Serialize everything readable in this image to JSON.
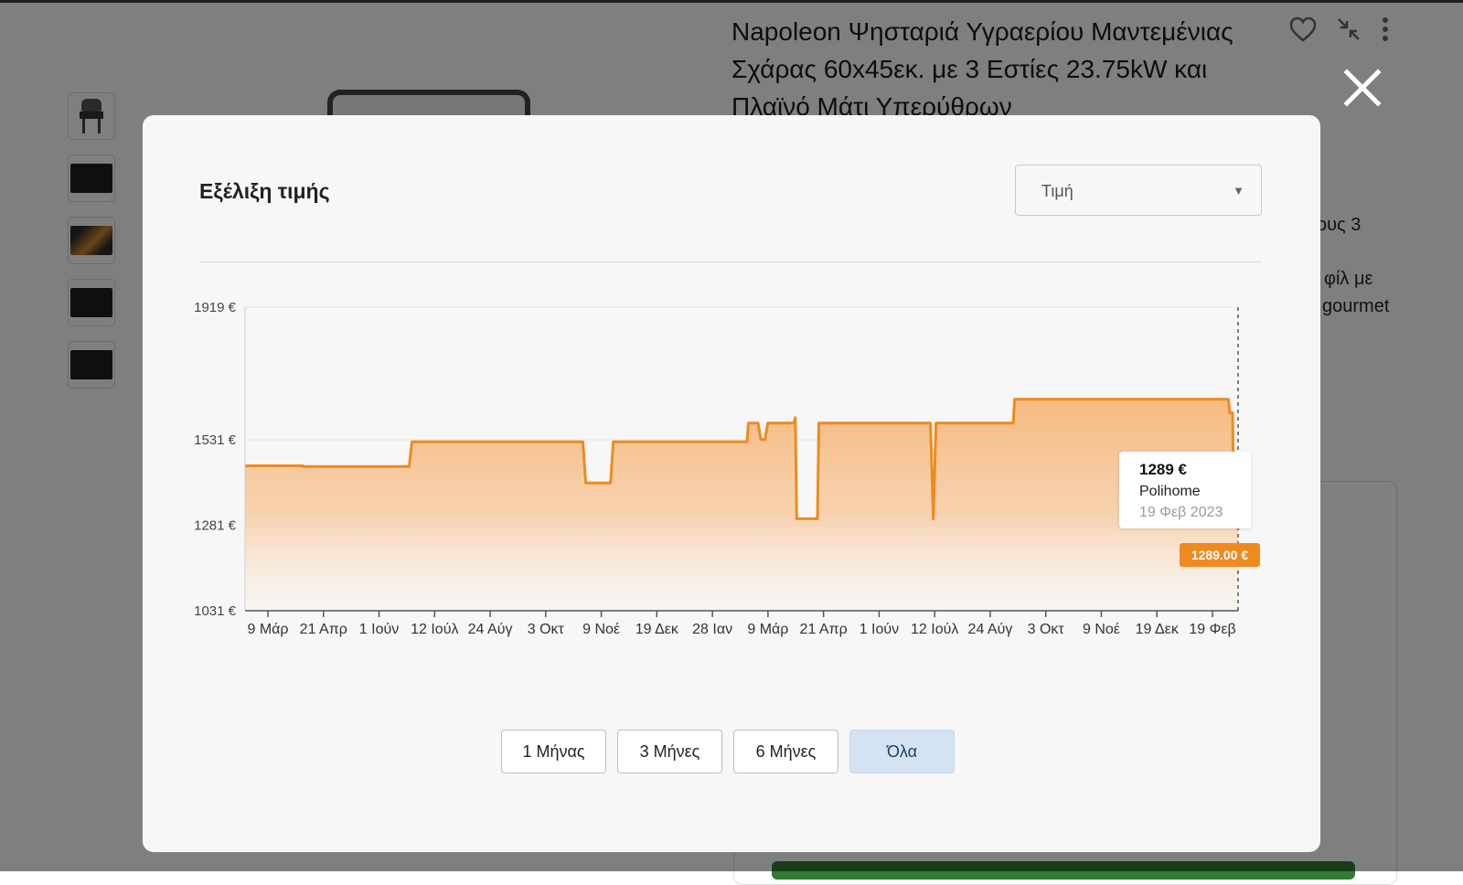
{
  "product": {
    "title": "Napoleon Ψησταριά Υγραερίου Μαντεμένιας Σχάρας 60x45εκ. με 3 Εστίες 23.75kW και Πλαϊνό Μάτι Υπερύθρων",
    "side_text_1": "ους 3",
    "side_text_2": "φίλ με",
    "side_text_3": "gourmet"
  },
  "modal": {
    "title": "Εξέλιξη τιμής",
    "select_value": "Τιμή",
    "range_buttons": [
      "1 Μήνας",
      "3 Μήνες",
      "6 Μήνες",
      "Όλα"
    ],
    "active_range": "Όλα"
  },
  "tooltip": {
    "price": "1289 €",
    "shop": "Polihome",
    "date": "19 Φεβ 2023",
    "badge": "1289.00 €"
  },
  "colors": {
    "line": "#ef8a1f",
    "fill_top": "#f5b77a",
    "active_button": "#d3e3f1",
    "badge": "#ef8a1f"
  },
  "chart_data": {
    "type": "area",
    "title": "",
    "xlabel": "",
    "ylabel": "",
    "y_ticks": [
      1919,
      1531,
      1281,
      1031
    ],
    "y_tick_labels": [
      "1919 €",
      "1531 €",
      "1281 €",
      "1031 €"
    ],
    "ylim": [
      1031,
      1919
    ],
    "x_tick_labels": [
      "9 Μάρ",
      "21 Απρ",
      "1 Ιούν",
      "12 Ιούλ",
      "24 Αύγ",
      "3 Οκτ",
      "9 Νοέ",
      "19 Δεκ",
      "28 Ιαν",
      "9 Μάρ",
      "21 Απρ",
      "1 Ιούν",
      "12 Ιούλ",
      "24 Αύγ",
      "3 Οκτ",
      "9 Νοέ",
      "19 Δεκ",
      "19 Φεβ"
    ],
    "xlim": [
      "2021-03-01",
      "2023-02-19"
    ],
    "grid": true,
    "series": [
      {
        "name": "Τιμή",
        "points": [
          [
            "2021-03-01",
            1455
          ],
          [
            "2021-04-12",
            1455
          ],
          [
            "2021-04-12",
            1453
          ],
          [
            "2021-06-28",
            1453
          ],
          [
            "2021-06-30",
            1525
          ],
          [
            "2021-11-01",
            1525
          ],
          [
            "2021-11-03",
            1405
          ],
          [
            "2021-11-21",
            1405
          ],
          [
            "2021-11-23",
            1525
          ],
          [
            "2022-02-28",
            1525
          ],
          [
            "2022-03-01",
            1580
          ],
          [
            "2022-03-08",
            1580
          ],
          [
            "2022-03-10",
            1532
          ],
          [
            "2022-03-13",
            1532
          ],
          [
            "2022-03-15",
            1580
          ],
          [
            "2022-04-03",
            1580
          ],
          [
            "2022-04-04",
            1596
          ],
          [
            "2022-04-05",
            1300
          ],
          [
            "2022-04-20",
            1300
          ],
          [
            "2022-04-21",
            1580
          ],
          [
            "2022-07-11",
            1580
          ],
          [
            "2022-07-13",
            1300
          ],
          [
            "2022-07-15",
            1580
          ],
          [
            "2022-09-09",
            1580
          ],
          [
            "2022-09-10",
            1650
          ],
          [
            "2023-02-12",
            1650
          ],
          [
            "2023-02-13",
            1610
          ],
          [
            "2023-02-15",
            1610
          ],
          [
            "2023-02-16",
            1289
          ],
          [
            "2023-02-19",
            1289
          ]
        ]
      }
    ],
    "highlight": {
      "x": "2023-02-19",
      "y": 1289
    }
  }
}
